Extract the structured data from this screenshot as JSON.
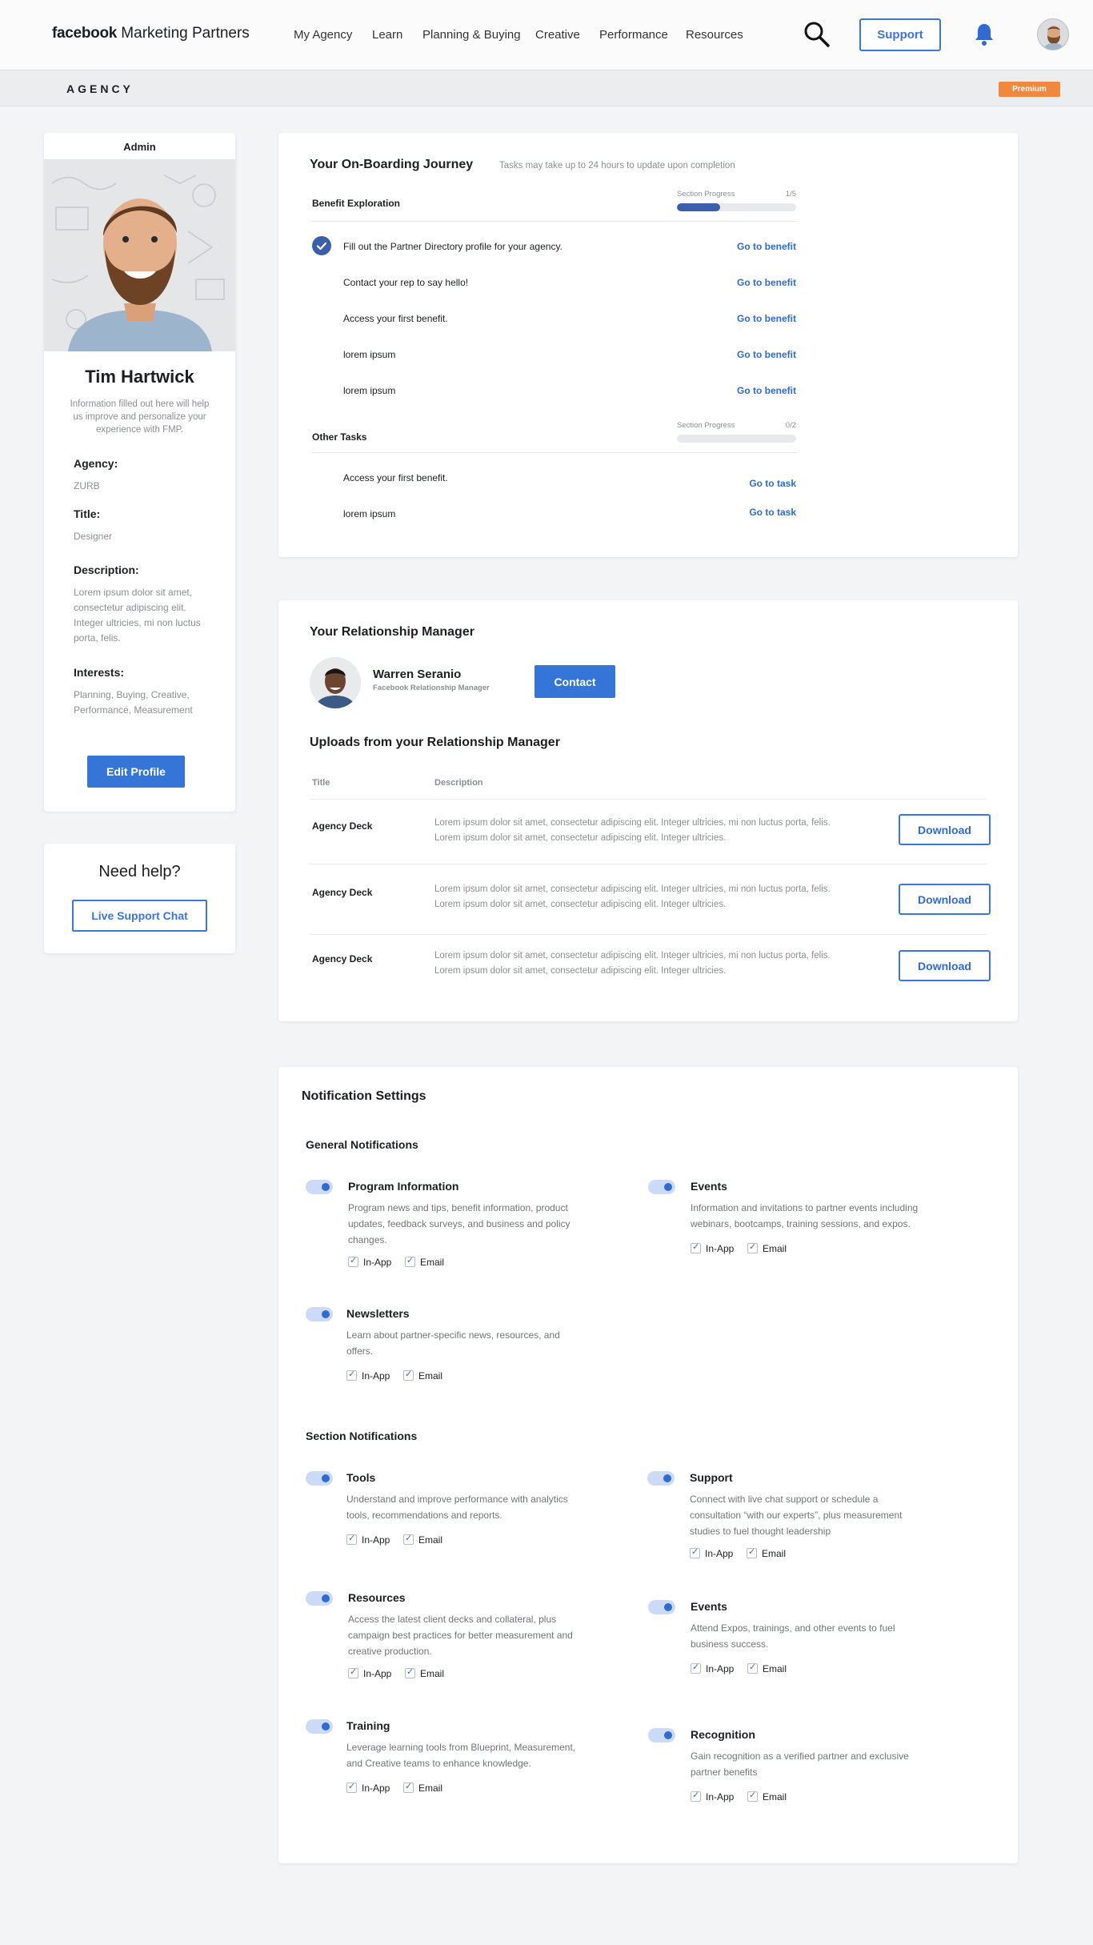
{
  "header": {
    "brand_bold": "facebook",
    "brand_rest": "Marketing Partners",
    "nav": [
      "My Agency",
      "Learn",
      "Planning & Buying",
      "Creative",
      "Performance",
      "Resources"
    ],
    "support_label": "Support"
  },
  "subbar": {
    "title": "AGENCY",
    "badge": "Premium"
  },
  "profile": {
    "role": "Admin",
    "name": "Tim Hartwick",
    "info": "Information filled out here will help us improve and personalize your experience with FMP.",
    "agency_label": "Agency:",
    "agency": "ZURB",
    "title_label": "Title:",
    "title": "Designer",
    "description_label": "Description:",
    "description": "Lorem ipsum dolor sit amet, consectetur adipiscing elit. Integer ultricies, mi non luctus porta, felis.",
    "interests_label": "Interests:",
    "interests": "Planning, Buying, Creative, Performance, Measurement",
    "edit_label": "Edit Profile"
  },
  "help": {
    "title": "Need help?",
    "button": "Live Support Chat"
  },
  "onboarding": {
    "title": "Your On-Boarding Journey",
    "subtitle": "Tasks may take up to 24 hours to update upon completion",
    "sections": [
      {
        "name": "Benefit Exploration",
        "progress_label": "Section Progress",
        "progress_text": "1/5",
        "progress": 0.36,
        "tasks": [
          {
            "text": "Fill out the Partner Directory profile for your agency.",
            "link": "Go to benefit",
            "done": true
          },
          {
            "text": "Contact your rep to say hello!",
            "link": "Go to benefit"
          },
          {
            "text": "Access your first benefit.",
            "link": "Go to benefit"
          },
          {
            "text": "lorem ipsum",
            "link": "Go to benefit"
          },
          {
            "text": "lorem ipsum",
            "link": "Go to benefit"
          }
        ]
      },
      {
        "name": "Other Tasks",
        "progress_label": "Section Progress",
        "progress_text": "0/2",
        "progress": 0,
        "tasks": [
          {
            "text": "Access your first benefit.",
            "link": "Go to task"
          },
          {
            "text": "lorem ipsum",
            "link": "Go to task"
          }
        ]
      }
    ]
  },
  "manager": {
    "title": "Your Relationship Manager",
    "name": "Warren Seranio",
    "role": "Facebook Relationship Manager",
    "contact_label": "Contact",
    "uploads_title": "Uploads from your Relationship Manager",
    "columns": [
      "Title",
      "Description"
    ],
    "rows": [
      {
        "title": "Agency Deck",
        "description": "Lorem ipsum dolor sit amet, consectetur adipiscing elit. Integer ultricies, mi non luctus porta, felis. Lorem ipsum dolor sit amet, consectetur adipiscing elit. Integer ultricies.",
        "action": "Download"
      },
      {
        "title": "Agency Deck",
        "description": "Lorem ipsum dolor sit amet, consectetur adipiscing elit. Integer ultricies, mi non luctus porta, felis. Lorem ipsum dolor sit amet, consectetur adipiscing elit. Integer ultricies.",
        "action": "Download"
      },
      {
        "title": "Agency Deck",
        "description": "Lorem ipsum dolor sit amet, consectetur adipiscing elit. Integer ultricies, mi non luctus porta, felis. Lorem ipsum dolor sit amet, consectetur adipiscing elit. Integer ultricies.",
        "action": "Download"
      }
    ]
  },
  "notifications": {
    "title": "Notification Settings",
    "inapp_label": "In-App",
    "email_label": "Email",
    "general_title": "General Notifications",
    "general": [
      {
        "title": "Program Information",
        "description": "Program news and tips, benefit information, product updates, feedback surveys, and business and policy changes."
      },
      {
        "title": "Events",
        "description": "Information and invitations to partner events including webinars, bootcamps, training sessions, and expos."
      },
      {
        "title": "Newsletters",
        "description": "Learn about partner-specific news, resources, and offers."
      }
    ],
    "section_title": "Section Notifications",
    "section": [
      {
        "title": "Tools",
        "description": "Understand and improve performance with analytics tools, recommendations and reports."
      },
      {
        "title": "Support",
        "description": "Connect with live chat support or schedule a consultation “with our experts”, plus measurement studies to fuel thought leadership"
      },
      {
        "title": "Resources",
        "description": "Access the latest client decks and collateral, plus campaign best practices for better measurement and creative production."
      },
      {
        "title": "Events",
        "description": "Attend Expos, trainings, and other events to fuel business success."
      },
      {
        "title": "Training",
        "description": "Leverage learning tools from Blueprint, Measurement, and Creative teams to enhance knowledge."
      },
      {
        "title": "Recognition",
        "description": "Gain recognition as a verified partner and exclusive partner benefits"
      }
    ]
  }
}
